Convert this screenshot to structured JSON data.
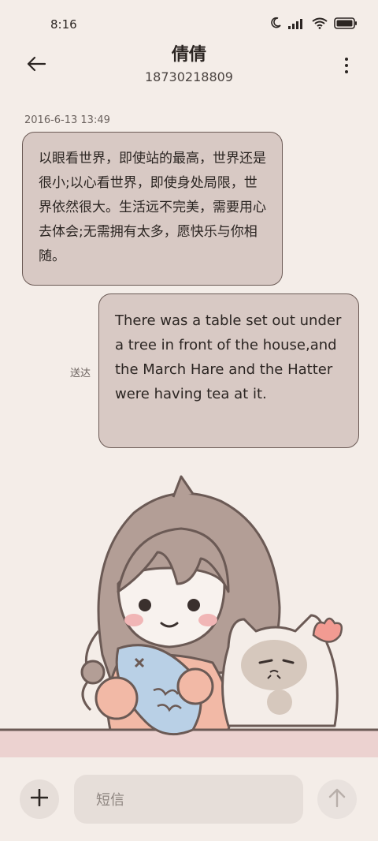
{
  "status_bar": {
    "time": "8:16"
  },
  "header": {
    "name": "倩倩",
    "number": "18730218809"
  },
  "conversation": {
    "timestamp": "2016-6-13 13:49",
    "messages": [
      {
        "direction": "incoming",
        "text": "以眼看世界，即使站的最高，世界还是很小;以心看世界，即使身处局限，世界依然很大。生活远不完美，需要用心去体会;无需拥有太多，愿快乐与你相随。"
      },
      {
        "direction": "outgoing",
        "text": "There was a table set out under a tree in front of the house,and the March Hare and the Hatter were having tea at it.",
        "status": "送达"
      }
    ]
  },
  "composer": {
    "placeholder": "短信"
  },
  "colors": {
    "background": "#f4ede8",
    "bubble": "#d8c9c4",
    "bubble_border": "#6b5a55"
  },
  "icons": [
    "back-arrow-icon",
    "more-vertical-icon",
    "plus-icon",
    "send-arrow-icon",
    "moon-icon",
    "signal-icon",
    "wifi-icon",
    "battery-icon"
  ]
}
